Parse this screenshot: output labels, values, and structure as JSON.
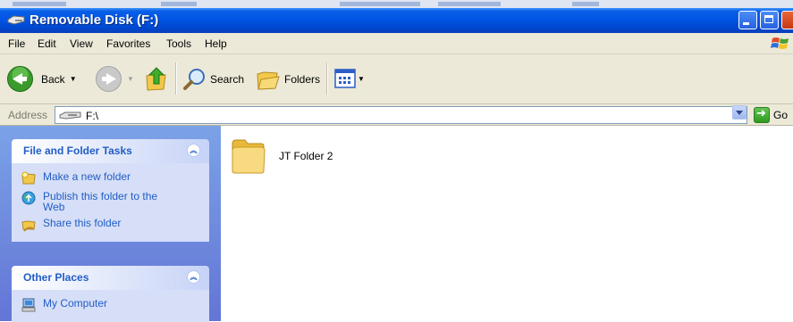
{
  "window": {
    "title": "Removable Disk (F:)"
  },
  "menu": [
    "File",
    "Edit",
    "View",
    "Favorites",
    "Tools",
    "Help"
  ],
  "toolbar": {
    "back": "Back",
    "search": "Search",
    "folders": "Folders"
  },
  "address": {
    "label": "Address",
    "value": "F:\\",
    "go": "Go"
  },
  "file_tasks": {
    "title": "File and Folder Tasks",
    "items": [
      "Make a new folder",
      "Publish this folder to the Web",
      "Share this folder"
    ]
  },
  "other_places": {
    "title": "Other Places",
    "items": [
      "My Computer"
    ]
  },
  "files": [
    {
      "name": "JT Folder 2",
      "icon": "folder-icon"
    }
  ]
}
